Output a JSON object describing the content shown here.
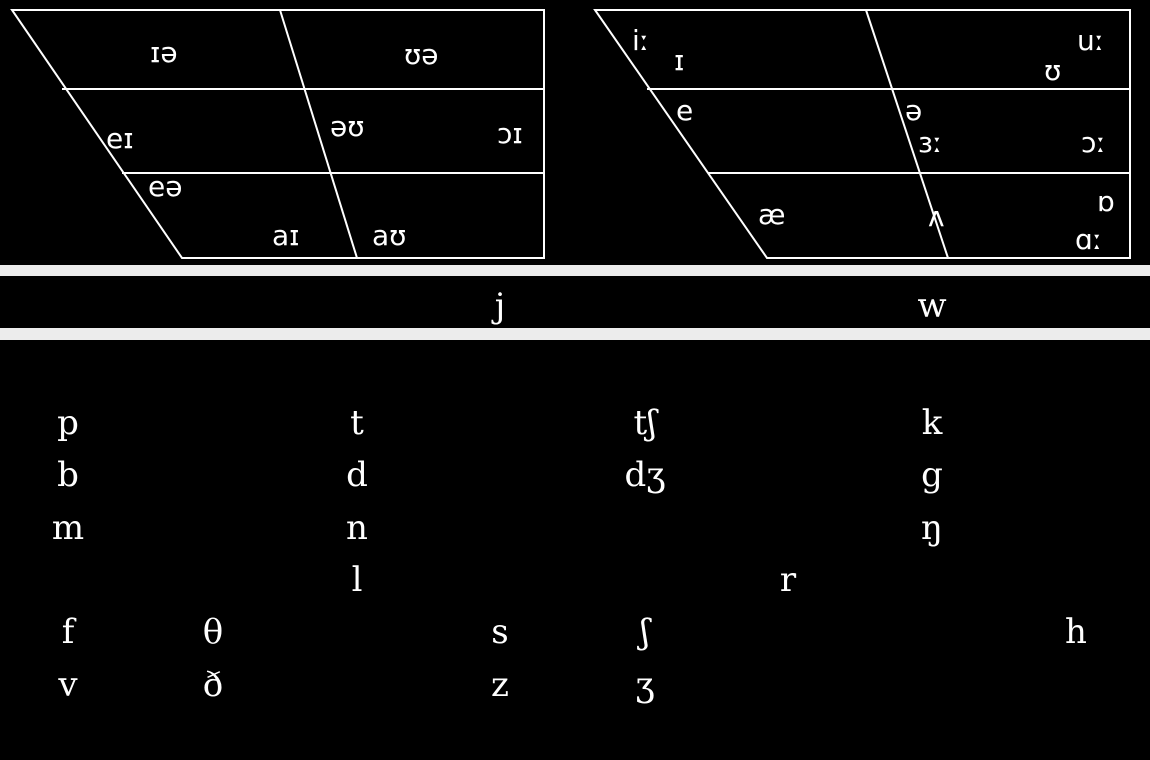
{
  "diphthongs": [
    "ɪə",
    "ʊə",
    "eɪ",
    "əʊ",
    "ɔɪ",
    "eə",
    "aɪ",
    "aʊ"
  ],
  "monophthongs": [
    "iː",
    "ɪ",
    "uː",
    "ʊ",
    "e",
    "ə",
    "ɜː",
    "ɔː",
    "æ",
    "ʌ",
    "ɒ",
    "ɑː"
  ],
  "glides": [
    "j",
    "w"
  ],
  "consonants": {
    "row1": [
      "p",
      "t",
      "tʃ",
      "k"
    ],
    "row2": [
      "b",
      "d",
      "dʒ",
      "g"
    ],
    "row3": [
      "m",
      "n",
      "ŋ"
    ],
    "row4": [
      "l",
      "r"
    ],
    "row5": [
      "f",
      "θ",
      "s",
      "ʃ",
      "h"
    ],
    "row6": [
      "v",
      "ð",
      "z",
      "ʒ"
    ]
  },
  "colors": {
    "background": "#000000",
    "foreground": "#ffffff",
    "separator": "#ececec"
  }
}
